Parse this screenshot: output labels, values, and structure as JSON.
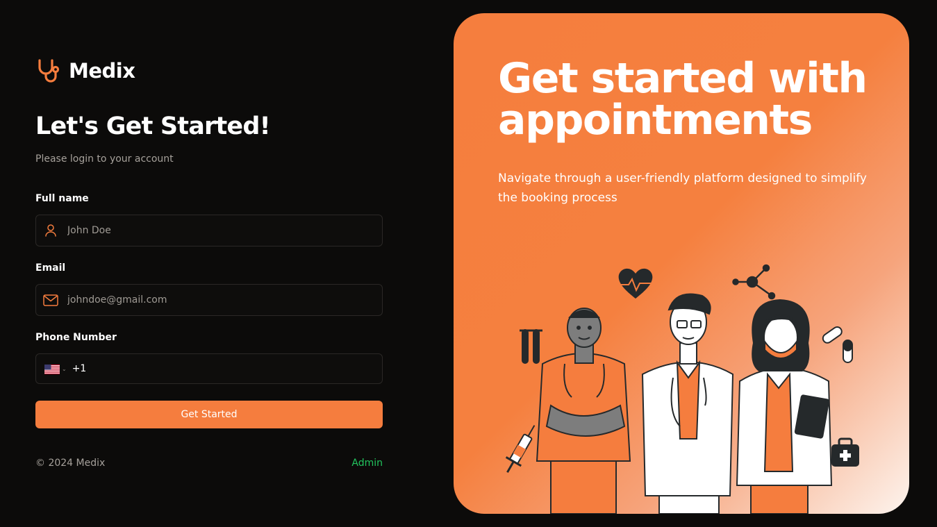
{
  "brand": {
    "name": "Medix",
    "accent": "#f57d3e",
    "logo_icon": "stethoscope-icon"
  },
  "form": {
    "title": "Let's Get Started!",
    "subtitle": "Please login to your account",
    "full_name": {
      "label": "Full name",
      "placeholder": "John Doe",
      "icon": "user-icon"
    },
    "email": {
      "label": "Email",
      "placeholder": "johndoe@gmail.com",
      "icon": "mail-icon"
    },
    "phone": {
      "label": "Phone Number",
      "country_flag": "us-flag-icon",
      "dial_code": "+1",
      "value": ""
    },
    "submit_label": "Get Started"
  },
  "footer": {
    "copyright": "© 2024 Medix",
    "admin_link": "Admin",
    "admin_color": "#22c55e"
  },
  "hero": {
    "title": "Get started with appointments",
    "subtitle": "Navigate through a user-friendly platform designed to simplify the booking process"
  }
}
